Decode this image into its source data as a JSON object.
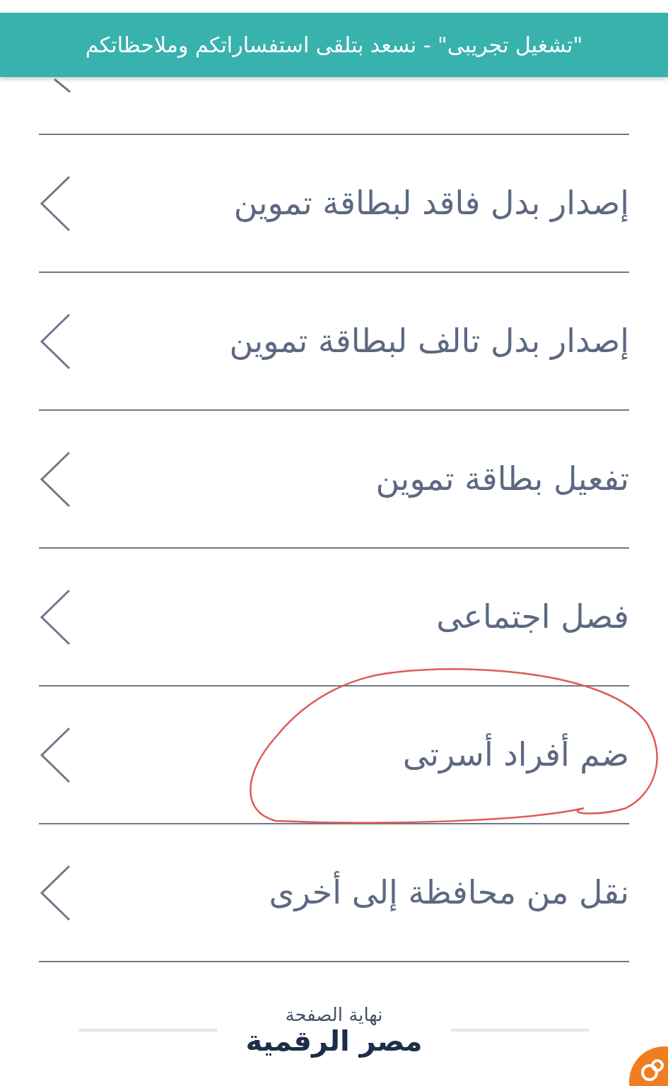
{
  "banner": {
    "text": "\"تشغيل تجريبى\" - نسعد بتلقى استفساراتكم وملاحظاتكم"
  },
  "items": [
    {
      "label": "إصدار بدل فاقد لبطاقة تموين"
    },
    {
      "label": "إصدار بدل تالف لبطاقة تموين"
    },
    {
      "label": "تفعيل بطاقة تموين"
    },
    {
      "label": "فصل اجتماعى"
    },
    {
      "label": "ضم أفراد أسرتى",
      "circled": true
    },
    {
      "label": "نقل من محافظة إلى أخرى"
    }
  ],
  "footer": {
    "caption": "نهاية الصفحة",
    "logo": "مصر الرقمية"
  }
}
